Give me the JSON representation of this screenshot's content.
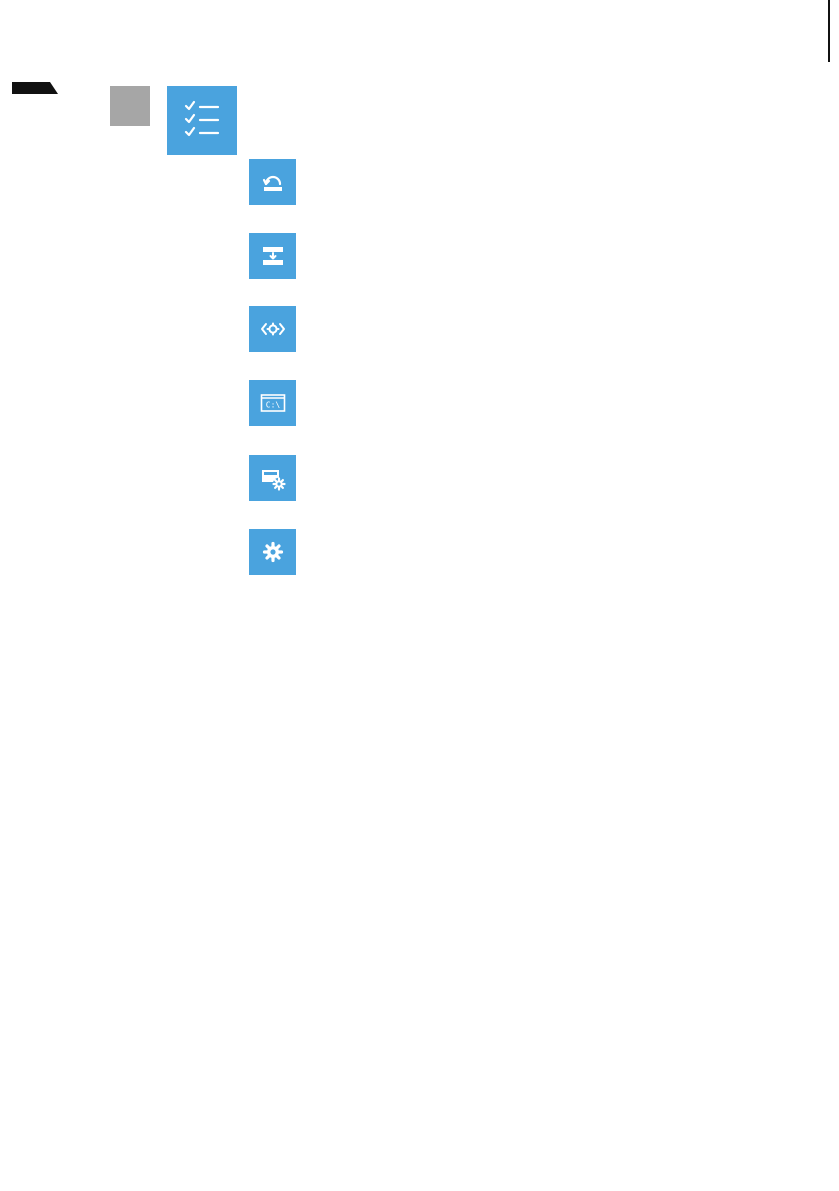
{
  "colors": {
    "tile_blue": "#4aa3de",
    "marker_gray": "#a6a6a6",
    "rule_black": "#111111",
    "icon_white": "#ffffff"
  },
  "icons": {
    "main": "checklist-icon",
    "options": [
      "system-restore-icon",
      "system-image-recovery-icon",
      "startup-repair-icon",
      "command-prompt-icon",
      "uefi-firmware-settings-icon",
      "startup-settings-icon"
    ]
  },
  "command_prompt_glyph": "C:\\"
}
